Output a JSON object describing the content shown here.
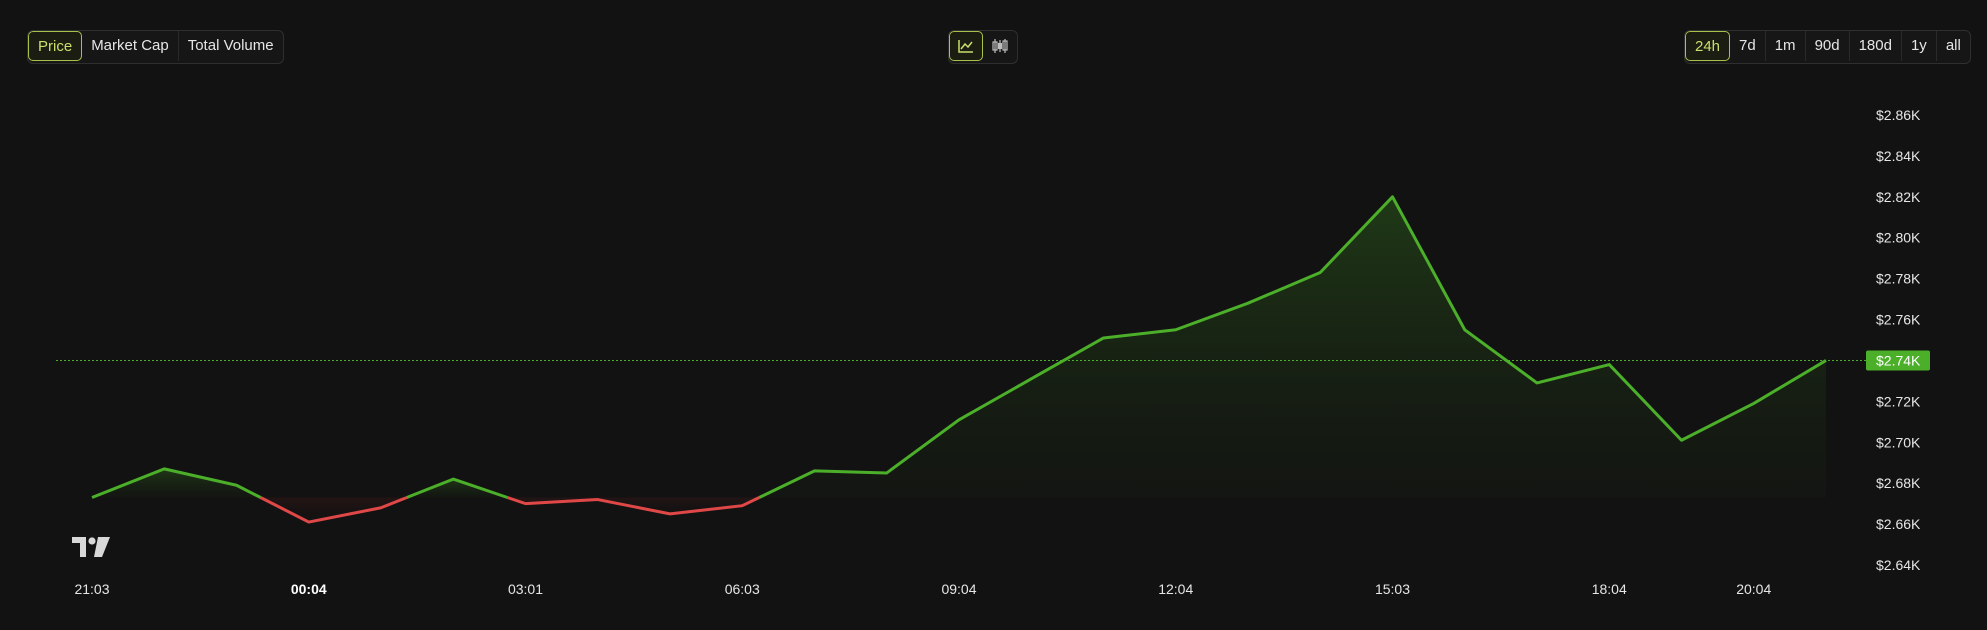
{
  "metric_tabs": [
    {
      "label": "Price",
      "active": true
    },
    {
      "label": "Market Cap",
      "active": false
    },
    {
      "label": "Total Volume",
      "active": false
    }
  ],
  "chart_type_buttons": [
    {
      "icon": "line-chart-icon",
      "active": true
    },
    {
      "icon": "candlestick-chart-icon",
      "active": false
    }
  ],
  "range_tabs": [
    {
      "label": "24h",
      "active": true
    },
    {
      "label": "7d",
      "active": false
    },
    {
      "label": "1m",
      "active": false
    },
    {
      "label": "90d",
      "active": false
    },
    {
      "label": "180d",
      "active": false
    },
    {
      "label": "1y",
      "active": false
    },
    {
      "label": "all",
      "active": false
    }
  ],
  "colors": {
    "up": "#4caf2a",
    "down": "#e04848",
    "accent": "#c8e06b",
    "background": "#121212"
  },
  "chart_data": {
    "type": "area",
    "x": [
      "21:03",
      "22:00",
      "23:00",
      "00:04",
      "01:00",
      "02:00",
      "03:01",
      "04:00",
      "05:00",
      "06:03",
      "07:00",
      "08:00",
      "09:04",
      "10:00",
      "11:00",
      "12:04",
      "13:00",
      "14:00",
      "15:03",
      "16:00",
      "17:00",
      "18:04",
      "19:00",
      "20:04",
      "21:00"
    ],
    "x_ticks": [
      "21:03",
      "00:04",
      "03:01",
      "06:03",
      "09:04",
      "12:04",
      "15:03",
      "18:04",
      "20:04"
    ],
    "x_ticks_bold": [
      "00:04"
    ],
    "values": [
      2.673,
      2.687,
      2.679,
      2.661,
      2.668,
      2.682,
      2.67,
      2.672,
      2.665,
      2.669,
      2.686,
      2.685,
      2.711,
      2.731,
      2.751,
      2.755,
      2.768,
      2.783,
      2.82,
      2.755,
      2.729,
      2.738,
      2.701,
      2.719,
      2.74
    ],
    "baseline": 2.673,
    "current_price_label": "$2.74K",
    "current_price": 2.74,
    "y_ticks": [
      {
        "value": 2.86,
        "label": "$2.86K"
      },
      {
        "value": 2.84,
        "label": "$2.84K"
      },
      {
        "value": 2.82,
        "label": "$2.82K"
      },
      {
        "value": 2.8,
        "label": "$2.80K"
      },
      {
        "value": 2.78,
        "label": "$2.78K"
      },
      {
        "value": 2.76,
        "label": "$2.76K"
      },
      {
        "value": 2.72,
        "label": "$2.72K"
      },
      {
        "value": 2.7,
        "label": "$2.70K"
      },
      {
        "value": 2.68,
        "label": "$2.68K"
      },
      {
        "value": 2.66,
        "label": "$2.66K"
      },
      {
        "value": 2.64,
        "label": "$2.64K"
      }
    ],
    "ylim": [
      2.64,
      2.86
    ],
    "grid": false,
    "watermark": "TradingView logo"
  }
}
